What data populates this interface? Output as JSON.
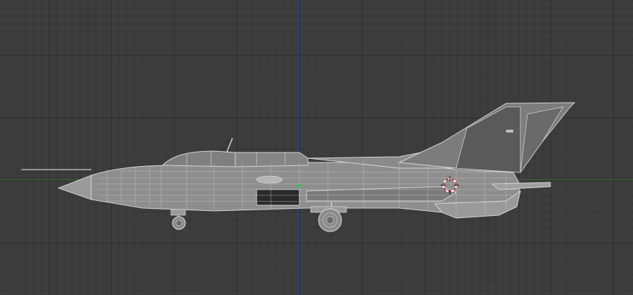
{
  "viewport": {
    "view": "right-orthographic",
    "grid": true,
    "colors": {
      "background": "#3d3d3d",
      "grid_minor": "#363636",
      "grid_major": "#2f2f2f",
      "axis_x": "#3f6b3f",
      "axis_z": "#2c3fa0",
      "wire": "#c9c9c9",
      "surface": "#8a8a8a",
      "dark_panel": "#5a5a5a",
      "origin": "#2ecc40",
      "cursor_red": "#d03030",
      "cursor_white": "#ffffff"
    }
  },
  "model": {
    "type": "aircraft",
    "display": "wireframe"
  },
  "icons": {
    "cursor": "3d-cursor-icon",
    "origin": "object-origin-icon"
  }
}
